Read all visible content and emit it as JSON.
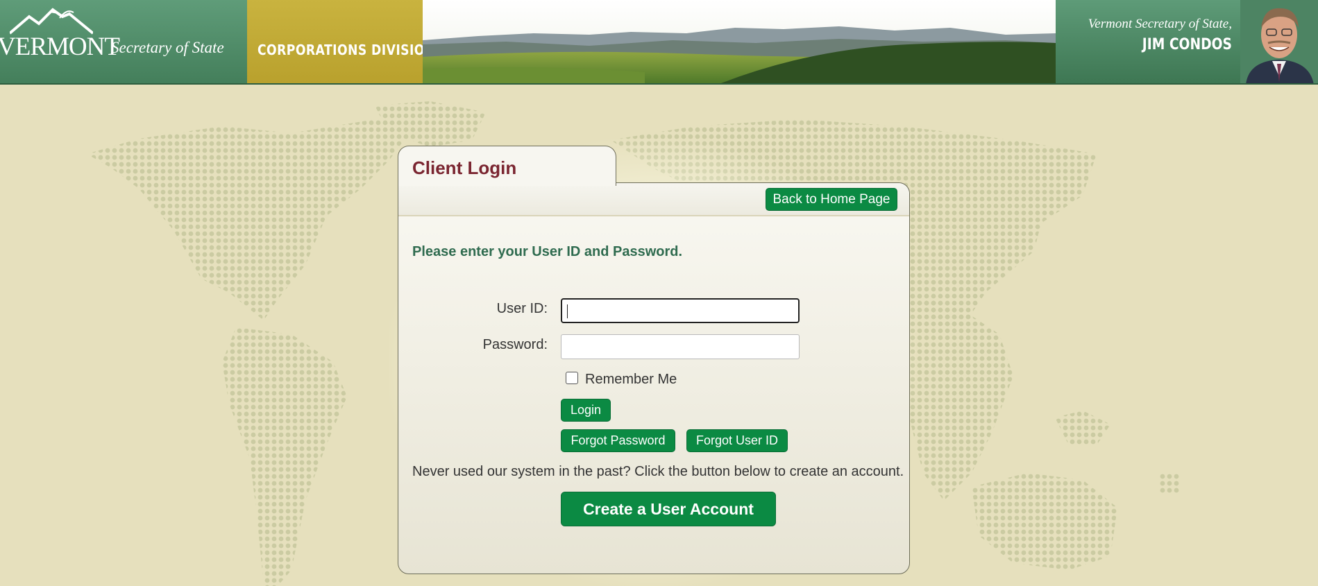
{
  "header": {
    "logo_word": "VERMONT",
    "logo_subtitle": "Secretary of State",
    "division": "CORPORATIONS DIVISION",
    "official_title": "Vermont Secretary of State,",
    "official_name": "JIM CONDOS",
    "colors": {
      "green": "#447f5b",
      "gold": "#c9b33f"
    }
  },
  "login": {
    "tab_title": "Client Login",
    "back_button": "Back to Home Page",
    "instruction": "Please enter your User ID and Password.",
    "user_id_label": "User ID:",
    "user_id_value": "",
    "password_label": "Password:",
    "password_value": "",
    "remember_label": "Remember Me",
    "remember_checked": false,
    "login_button": "Login",
    "forgot_password_button": "Forgot Password",
    "forgot_user_button": "Forgot User ID",
    "signup_prompt": "Never used our system in the past? Click the button below to create an account.",
    "create_account_button": "Create a User Account",
    "colors": {
      "button_green": "#0b8a43",
      "title_maroon": "#7a2530",
      "instruction_green": "#2f6b4f"
    }
  }
}
